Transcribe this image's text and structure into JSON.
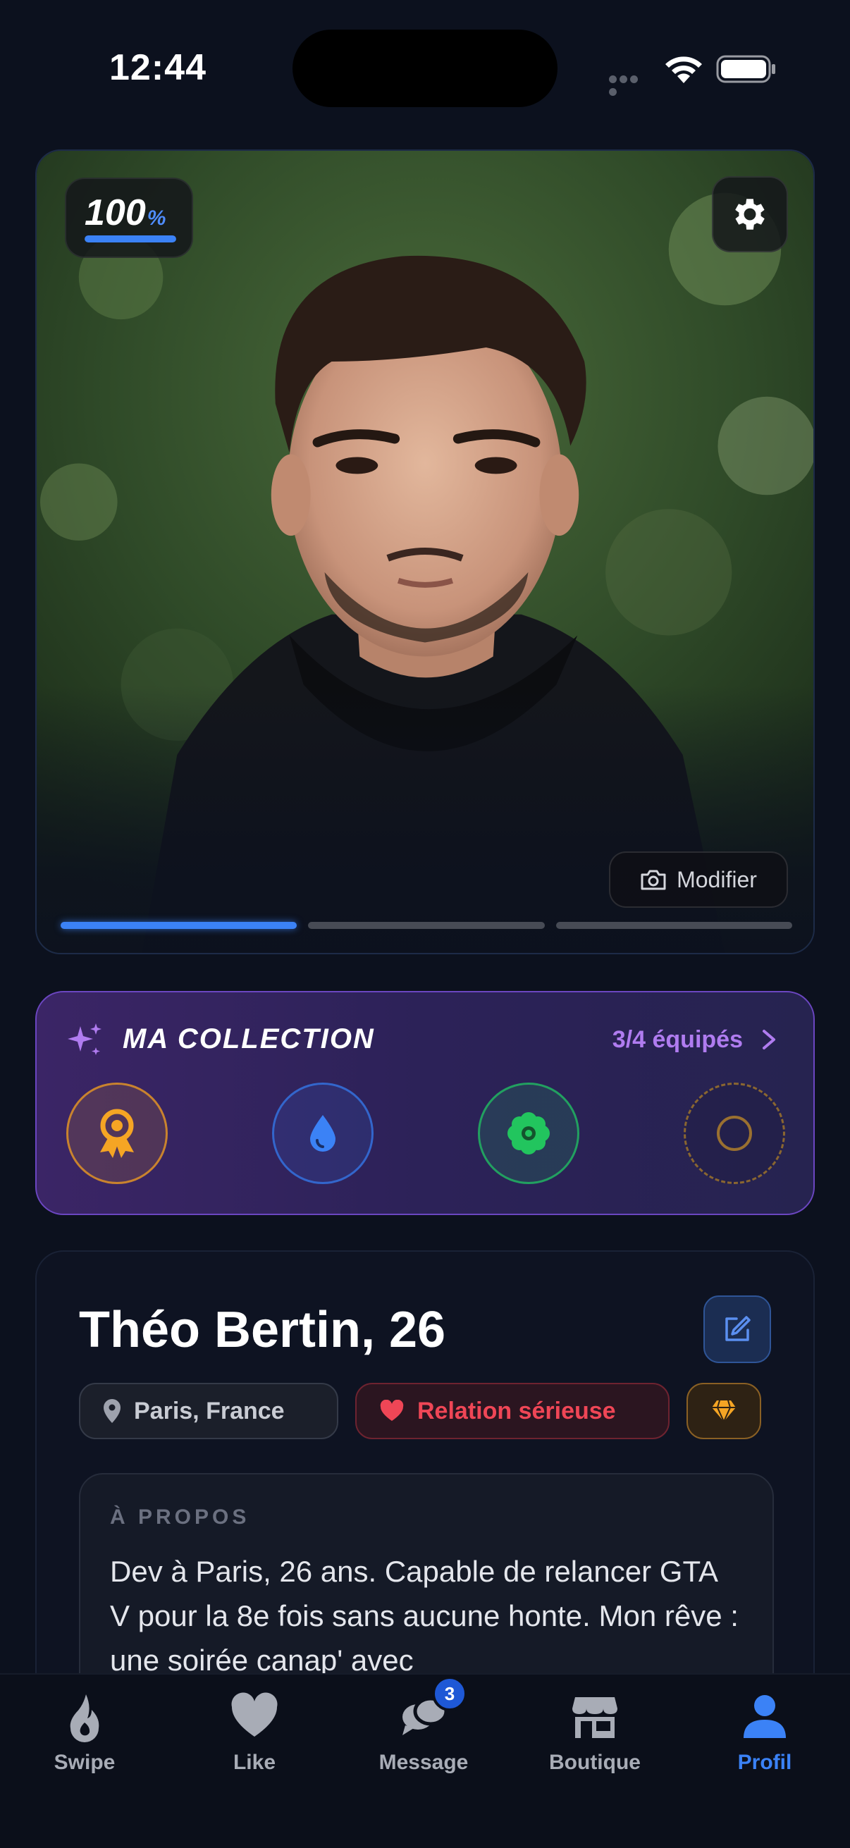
{
  "status_bar": {
    "time": "12:44"
  },
  "profile_photo": {
    "completion_value": "100",
    "completion_unit": "%",
    "completion_fraction": 1.0,
    "modify_label": "Modifier",
    "photo_count": 3,
    "active_photo_index": 0
  },
  "collection": {
    "title": "MA COLLECTION",
    "count_text": "3/4 équipés",
    "items": [
      {
        "icon": "award-icon",
        "color": "#f5a524"
      },
      {
        "icon": "water-drop-icon",
        "color": "#3b82f6"
      },
      {
        "icon": "flower-icon",
        "color": "#22c55e"
      },
      {
        "icon": "empty-slot-icon",
        "color": "#9a7030"
      }
    ]
  },
  "profile": {
    "name": "Théo Bertin, 26",
    "location": "Paris, France",
    "relationship": "Relation sérieuse",
    "about_label": "À PROPOS",
    "about_text": "Dev à Paris, 26 ans. Capable de relancer GTA V pour la 8e fois sans aucune honte. Mon rêve : une soirée canap' avec"
  },
  "nav": {
    "items": [
      {
        "label": "Swipe",
        "icon": "flame-icon"
      },
      {
        "label": "Like",
        "icon": "heart-icon"
      },
      {
        "label": "Message",
        "icon": "chat-icon",
        "badge": "3"
      },
      {
        "label": "Boutique",
        "icon": "store-icon"
      },
      {
        "label": "Profil",
        "icon": "user-icon"
      }
    ],
    "active": "Profil"
  },
  "colors": {
    "accent": "#3b82f6",
    "background": "#0c111e",
    "collection_purple": "#b07cf0",
    "relation_red": "#ef4656"
  }
}
